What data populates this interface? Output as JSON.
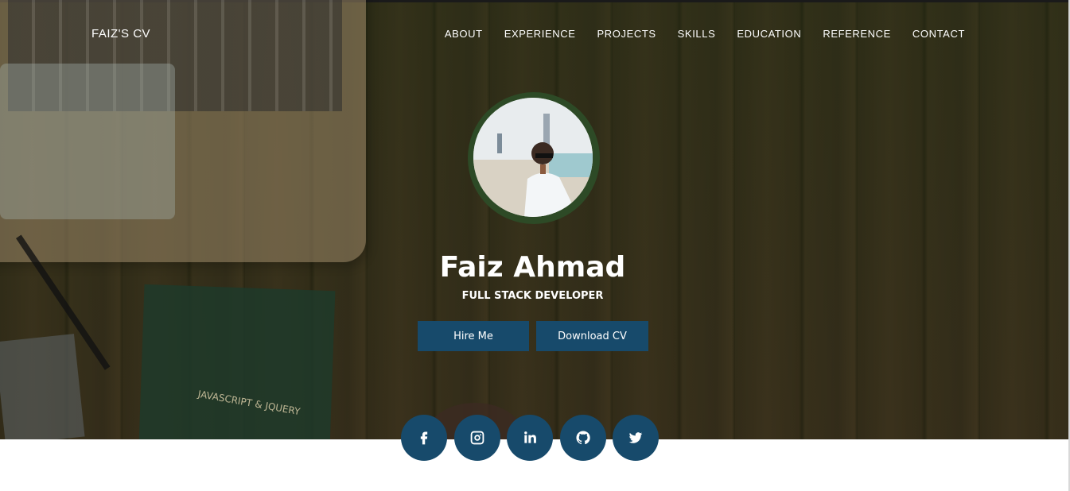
{
  "brand": "FAIZ'S CV",
  "nav": [
    "ABOUT",
    "EXPERIENCE",
    "PROJECTS",
    "SKILLS",
    "EDUCATION",
    "REFERENCE",
    "CONTACT"
  ],
  "hero": {
    "name": "Faiz Ahmad",
    "role": "FULL STACK DEVELOPER",
    "hire_label": "Hire Me",
    "download_label": "Download CV"
  },
  "book_text": "JAVASCRIPT & JQUERY",
  "socials": [
    "facebook-icon",
    "instagram-icon",
    "linkedin-icon",
    "github-icon",
    "twitter-icon"
  ],
  "colors": {
    "accent": "#174a6b",
    "text": "#ffffff"
  }
}
